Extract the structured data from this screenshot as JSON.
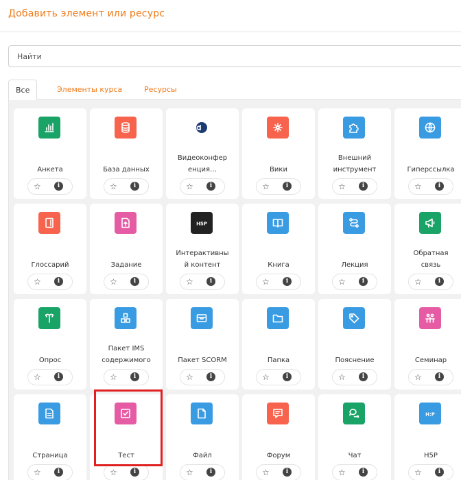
{
  "header": {
    "title": "Добавить элемент или ресурс"
  },
  "search": {
    "placeholder": "Найти"
  },
  "tabs": [
    {
      "label": "Все",
      "active": true
    },
    {
      "label": "Элементы курса",
      "active": false
    },
    {
      "label": "Ресурсы",
      "active": false
    }
  ],
  "colors": {
    "accent": "#ee7b1b",
    "activity_green": "#1aa366",
    "activity_blue": "#399be2",
    "activity_red": "#f7634d",
    "activity_pink": "#e65ca4",
    "highlight": "#e02020"
  },
  "footer": {
    "star_glyph": "☆",
    "info_glyph": "i"
  },
  "items": [
    {
      "label": "Анкета",
      "icon": "chart-bars-icon",
      "color": "#1aa366"
    },
    {
      "label": "База данных",
      "icon": "database-icon",
      "color": "#f7634d"
    },
    {
      "label": "Видеоконференция…",
      "lines": [
        "Видеоконфер",
        "енция…"
      ],
      "icon": "bigbluebutton-icon",
      "color": "#ffffff"
    },
    {
      "label": "Вики",
      "icon": "wiki-nodes-icon",
      "color": "#f7634d"
    },
    {
      "label": "Внешний инструмент",
      "lines": [
        "Внешний",
        "инструмент"
      ],
      "icon": "puzzle-icon",
      "color": "#399be2"
    },
    {
      "label": "Гиперссылка",
      "icon": "globe-icon",
      "color": "#399be2"
    },
    {
      "label": "Глоссарий",
      "icon": "glossary-book-icon",
      "color": "#f7634d"
    },
    {
      "label": "Задание",
      "icon": "assignment-upload-icon",
      "color": "#e65ca4"
    },
    {
      "label": "Интерактивный контент",
      "lines": [
        "Интерактивны",
        "й контент"
      ],
      "icon": "h5p-logo-icon",
      "color": "#222222"
    },
    {
      "label": "Книга",
      "icon": "book-icon",
      "color": "#399be2"
    },
    {
      "label": "Лекция",
      "icon": "lesson-path-icon",
      "color": "#399be2"
    },
    {
      "label": "Обратная связь",
      "lines": [
        "Обратная",
        "связь"
      ],
      "icon": "megaphone-icon",
      "color": "#1aa366"
    },
    {
      "label": "Опрос",
      "icon": "choice-signpost-icon",
      "color": "#1aa366"
    },
    {
      "label": "Пакет IMS содержимого",
      "lines": [
        "Пакет IMS",
        "содержимого"
      ],
      "icon": "ims-boxes-icon",
      "color": "#399be2"
    },
    {
      "label": "Пакет SCORM",
      "icon": "scorm-box-icon",
      "color": "#399be2"
    },
    {
      "label": "Папка",
      "icon": "folder-icon",
      "color": "#399be2"
    },
    {
      "label": "Пояснение",
      "icon": "label-tag-icon",
      "color": "#399be2"
    },
    {
      "label": "Семинар",
      "icon": "workshop-people-icon",
      "color": "#e65ca4"
    },
    {
      "label": "Страница",
      "icon": "page-icon",
      "color": "#399be2"
    },
    {
      "label": "Тест",
      "icon": "quiz-checkbox-icon",
      "color": "#e65ca4"
    },
    {
      "label": "Файл",
      "icon": "file-icon",
      "color": "#399be2"
    },
    {
      "label": "Форум",
      "icon": "forum-bubble-icon",
      "color": "#f7634d"
    },
    {
      "label": "Чат",
      "icon": "chat-bubbles-icon",
      "color": "#1aa366"
    },
    {
      "label": "H5P",
      "icon": "h5p-logo-icon",
      "color": "#399be2"
    }
  ],
  "h5p_logo_text": "H5P",
  "h5p_logo_text_alt": "H:P"
}
